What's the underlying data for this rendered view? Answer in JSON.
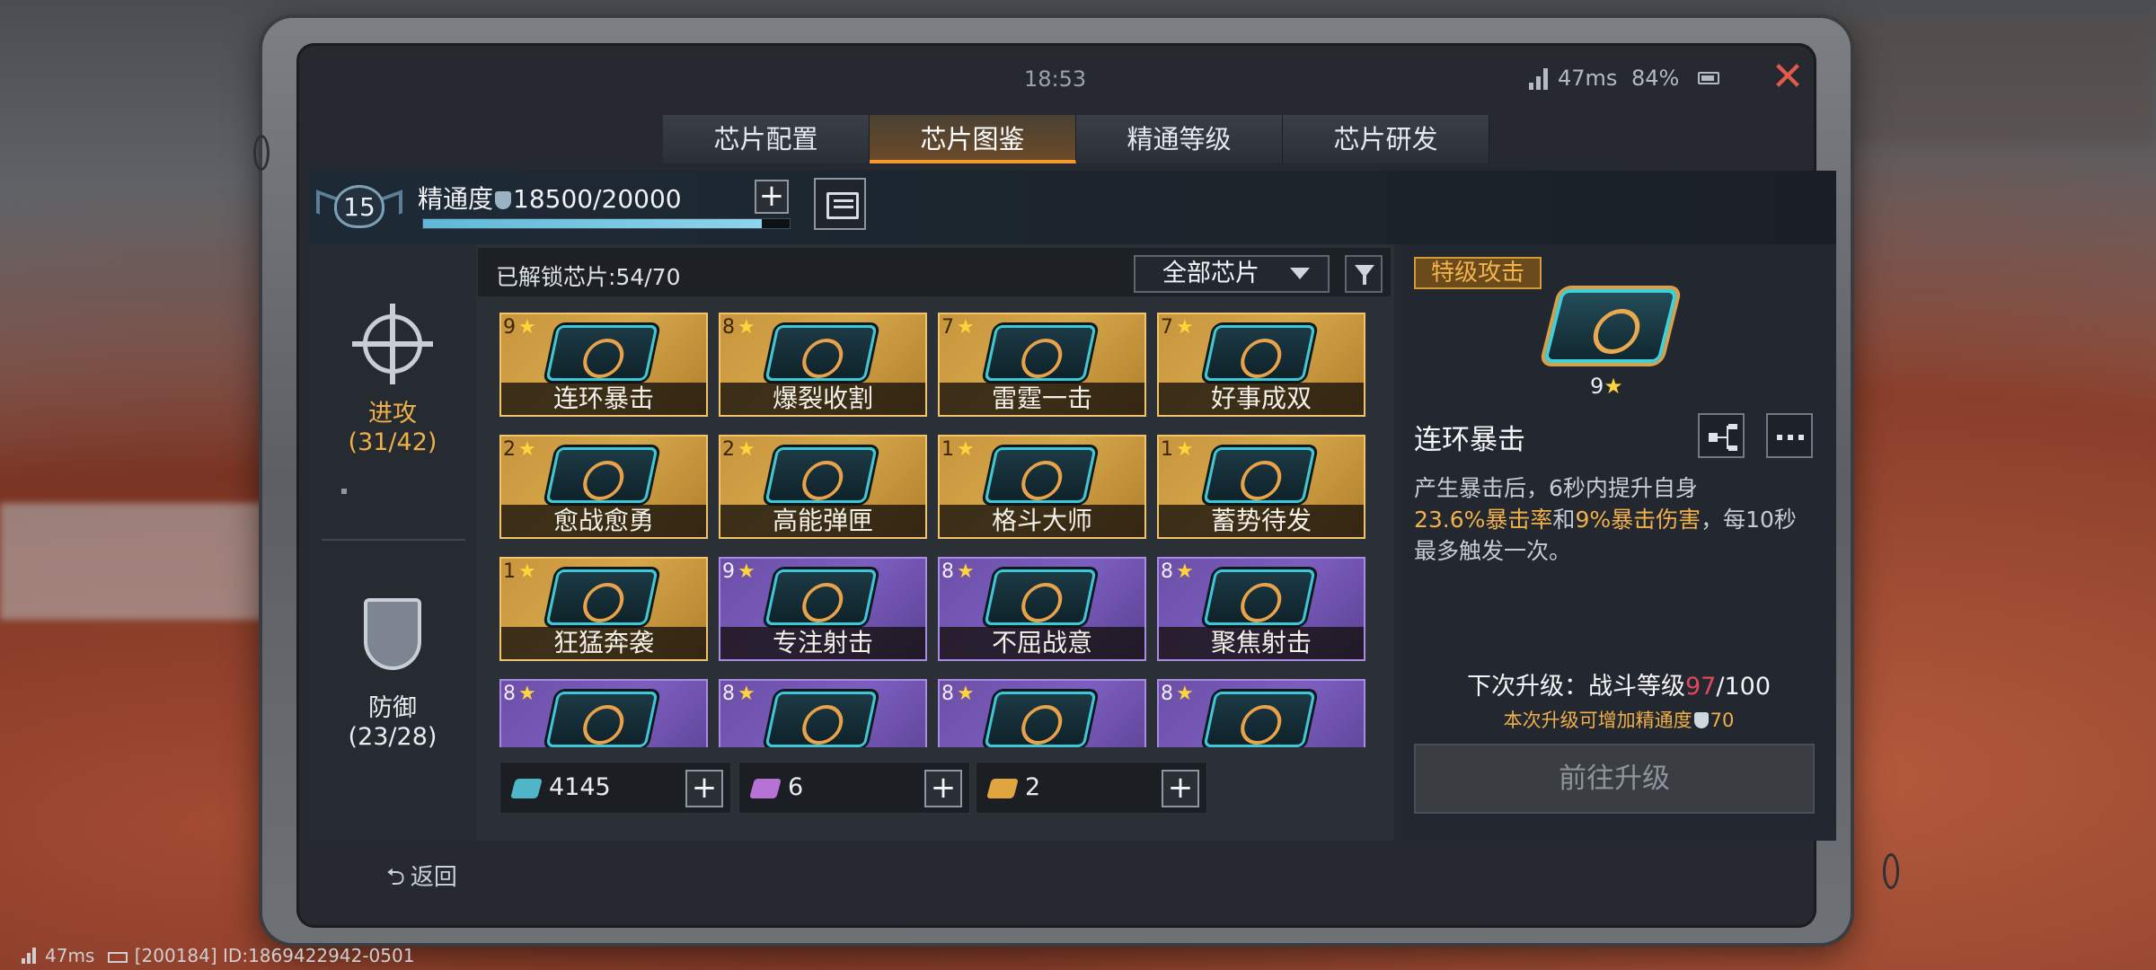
{
  "status": {
    "time": "18:53",
    "ping": "47ms",
    "battery": "84%"
  },
  "tabs": [
    {
      "label": "芯片配置",
      "active": false
    },
    {
      "label": "芯片图鉴",
      "active": true
    },
    {
      "label": "精通等级",
      "active": false
    },
    {
      "label": "芯片研发",
      "active": false
    }
  ],
  "header": {
    "level": "15",
    "mastery_label": "精通度",
    "mastery_value": "18500/20000",
    "mastery_progress": 0.925
  },
  "sidebar": {
    "attack": {
      "label": "进攻",
      "count": "(31/42)"
    },
    "defense": {
      "label": "防御",
      "count": "(23/28)"
    }
  },
  "grid": {
    "unlocked": "已解锁芯片:54/70",
    "filter": "全部芯片",
    "cards": [
      {
        "name": "连环暴击",
        "stars": "9",
        "tier": "gold"
      },
      {
        "name": "爆裂收割",
        "stars": "8",
        "tier": "gold"
      },
      {
        "name": "雷霆一击",
        "stars": "7",
        "tier": "gold"
      },
      {
        "name": "好事成双",
        "stars": "7",
        "tier": "gold"
      },
      {
        "name": "愈战愈勇",
        "stars": "2",
        "tier": "gold"
      },
      {
        "name": "高能弹匣",
        "stars": "2",
        "tier": "gold"
      },
      {
        "name": "格斗大师",
        "stars": "1",
        "tier": "gold"
      },
      {
        "name": "蓄势待发",
        "stars": "1",
        "tier": "gold"
      },
      {
        "name": "狂猛奔袭",
        "stars": "1",
        "tier": "gold"
      },
      {
        "name": "专注射击",
        "stars": "9",
        "tier": "purple"
      },
      {
        "name": "不屈战意",
        "stars": "8",
        "tier": "purple"
      },
      {
        "name": "聚焦射击",
        "stars": "8",
        "tier": "purple"
      },
      {
        "name": "",
        "stars": "8",
        "tier": "purple"
      },
      {
        "name": "",
        "stars": "8",
        "tier": "purple"
      },
      {
        "name": "",
        "stars": "8",
        "tier": "purple"
      },
      {
        "name": "",
        "stars": "8",
        "tier": "purple"
      }
    ]
  },
  "currencies": [
    {
      "value": "4145",
      "color": "#4fb6c8"
    },
    {
      "value": "6",
      "color": "#b772d6"
    },
    {
      "value": "2",
      "color": "#e0a53f"
    }
  ],
  "detail": {
    "type": "特级攻击",
    "stars": "9",
    "name": "连环暴击",
    "desc_1": "产生暴击后，6秒内提升自身",
    "desc_hl1": "23.6%暴击率",
    "desc_mid": "和",
    "desc_hl2": "9%暴击伤害",
    "desc_2": "，每10秒最多触发一次。",
    "next_prefix": "下次升级：战斗等级",
    "next_current": "97",
    "next_total": "/100",
    "next_sub_prefix": "本次升级可增加精通度",
    "next_sub_value": "70",
    "go_button": "前往升级"
  },
  "footer": {
    "back": "返回",
    "ping": "47ms",
    "info": "[200184] ID:1869422942-0501"
  }
}
